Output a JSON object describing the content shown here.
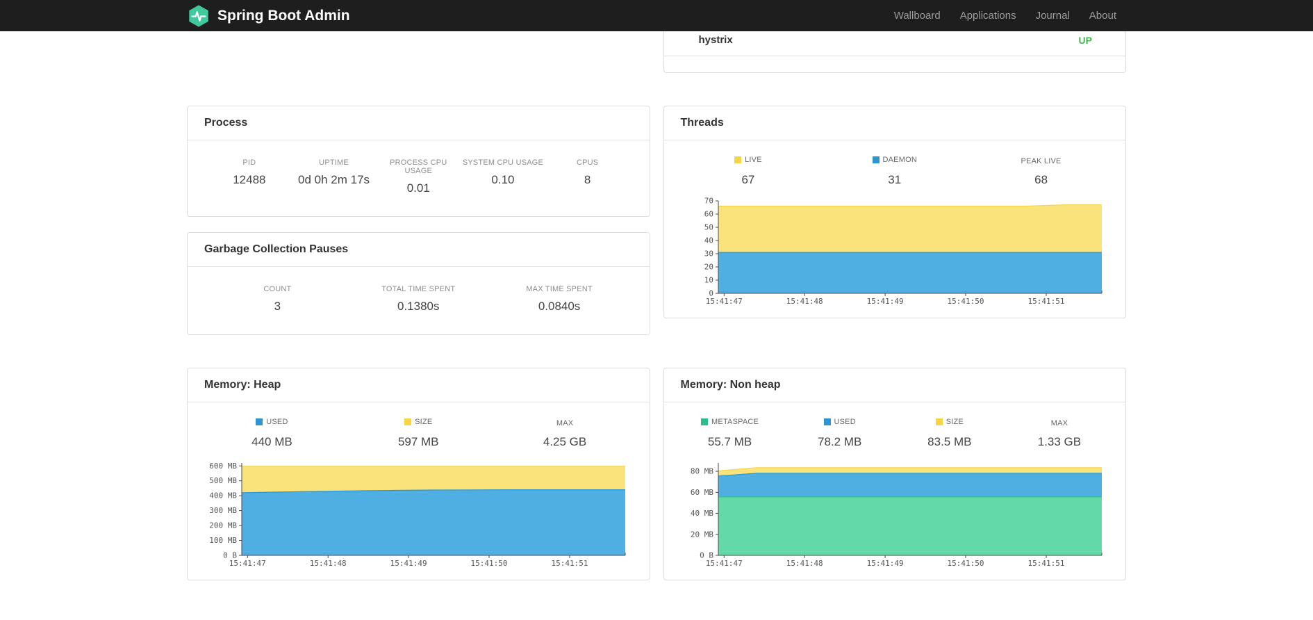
{
  "navbar": {
    "brand": "Spring Boot Admin",
    "brand_color": "#41c99e",
    "links": [
      {
        "label": "Wallboard"
      },
      {
        "label": "Applications"
      },
      {
        "label": "Journal"
      },
      {
        "label": "About"
      }
    ]
  },
  "health": {
    "rows": [
      {
        "name": "hystrix",
        "status": "UP",
        "status_color": "#43b749"
      }
    ]
  },
  "panels": {
    "process": {
      "title": "Process",
      "metrics": [
        {
          "label": "PID",
          "value": "12488"
        },
        {
          "label": "UPTIME",
          "value": "0d 0h 2m 17s"
        },
        {
          "label": "PROCESS CPU USAGE",
          "value": "0.01"
        },
        {
          "label": "SYSTEM CPU USAGE",
          "value": "0.10"
        },
        {
          "label": "CPUS",
          "value": "8"
        }
      ]
    },
    "gc": {
      "title": "Garbage Collection Pauses",
      "metrics": [
        {
          "label": "COUNT",
          "value": "3"
        },
        {
          "label": "TOTAL TIME SPENT",
          "value": "0.1380s"
        },
        {
          "label": "MAX TIME SPENT",
          "value": "0.0840s"
        }
      ]
    },
    "threads": {
      "title": "Threads",
      "legend": [
        {
          "label": "LIVE",
          "value": "67",
          "color": "#f6d645"
        },
        {
          "label": "DAEMON",
          "value": "31",
          "color": "#2d95d2"
        },
        {
          "label": "PEAK LIVE",
          "value": "68"
        }
      ]
    },
    "heap": {
      "title": "Memory: Heap",
      "legend": [
        {
          "label": "USED",
          "value": "440 MB",
          "color": "#2d95d2"
        },
        {
          "label": "SIZE",
          "value": "597 MB",
          "color": "#f6d645"
        },
        {
          "label": "MAX",
          "value": "4.25 GB"
        }
      ]
    },
    "nonheap": {
      "title": "Memory: Non heap",
      "legend": [
        {
          "label": "METASPACE",
          "value": "55.7 MB",
          "color": "#2dbd8d"
        },
        {
          "label": "USED",
          "value": "78.2 MB",
          "color": "#2d95d2"
        },
        {
          "label": "SIZE",
          "value": "83.5 MB",
          "color": "#f6d645"
        },
        {
          "label": "MAX",
          "value": "1.33 GB"
        }
      ]
    }
  },
  "chart_data": [
    {
      "id": "threads",
      "type": "area",
      "title": "Threads",
      "xlabel": "",
      "ylabel": "",
      "x": [
        "15:41:47",
        "15:41:48",
        "15:41:49",
        "15:41:50",
        "15:41:51"
      ],
      "ylim": [
        0,
        70
      ],
      "yticks": [
        {
          "v": 0,
          "label": "0"
        },
        {
          "v": 10,
          "label": "10"
        },
        {
          "v": 20,
          "label": "20"
        },
        {
          "v": 30,
          "label": "30"
        },
        {
          "v": 40,
          "label": "40"
        },
        {
          "v": 50,
          "label": "50"
        },
        {
          "v": 60,
          "label": "60"
        },
        {
          "v": 70,
          "label": "70"
        }
      ],
      "series": [
        {
          "name": "DAEMON",
          "color": "#2d95d2",
          "fill": "#4fafe2",
          "values": [
            31,
            31,
            31,
            31,
            31,
            31,
            31,
            31,
            31,
            31,
            31
          ]
        },
        {
          "name": "LIVE",
          "color": "#f6d645",
          "fill": "#fbe37b",
          "values": [
            66,
            66,
            66,
            66,
            66,
            66,
            66,
            66,
            66,
            67,
            67
          ]
        }
      ]
    },
    {
      "id": "heap",
      "type": "area",
      "title": "Memory: Heap",
      "xlabel": "",
      "ylabel": "",
      "x": [
        "15:41:47",
        "15:41:48",
        "15:41:49",
        "15:41:50",
        "15:41:51"
      ],
      "ylim": [
        0,
        620
      ],
      "yticks": [
        {
          "v": 0,
          "label": "0 B"
        },
        {
          "v": 100,
          "label": "100 MB"
        },
        {
          "v": 200,
          "label": "200 MB"
        },
        {
          "v": 300,
          "label": "300 MB"
        },
        {
          "v": 400,
          "label": "400 MB"
        },
        {
          "v": 500,
          "label": "500 MB"
        },
        {
          "v": 600,
          "label": "600 MB"
        }
      ],
      "series": [
        {
          "name": "USED",
          "color": "#2d95d2",
          "fill": "#4fafe2",
          "values": [
            420,
            425,
            429,
            433,
            436,
            438,
            439,
            440,
            440,
            440,
            440
          ]
        },
        {
          "name": "SIZE",
          "color": "#f6d645",
          "fill": "#fbe37b",
          "values": [
            597,
            597,
            597,
            597,
            597,
            597,
            597,
            597,
            597,
            597,
            597
          ]
        }
      ]
    },
    {
      "id": "nonheap",
      "type": "area",
      "title": "Memory: Non heap",
      "xlabel": "",
      "ylabel": "",
      "x": [
        "15:41:47",
        "15:41:48",
        "15:41:49",
        "15:41:50",
        "15:41:51"
      ],
      "ylim": [
        0,
        88
      ],
      "yticks": [
        {
          "v": 0,
          "label": "0 B"
        },
        {
          "v": 20,
          "label": "20 MB"
        },
        {
          "v": 40,
          "label": "40 MB"
        },
        {
          "v": 60,
          "label": "60 MB"
        },
        {
          "v": 80,
          "label": "80 MB"
        }
      ],
      "series": [
        {
          "name": "METASPACE",
          "color": "#2dbd8d",
          "fill": "#63d9a8",
          "values": [
            55.7,
            55.7,
            55.7,
            55.7,
            55.7,
            55.7,
            55.7,
            55.7,
            55.7,
            55.7,
            55.7
          ]
        },
        {
          "name": "USED",
          "color": "#2d95d2",
          "fill": "#4fafe2",
          "values": [
            75.5,
            78.2,
            78.2,
            78.2,
            78.2,
            78.2,
            78.2,
            78.2,
            78.2,
            78.2,
            78.2
          ]
        },
        {
          "name": "SIZE",
          "color": "#f6d645",
          "fill": "#fbe37b",
          "values": [
            80.5,
            83.5,
            83.5,
            83.5,
            83.5,
            83.5,
            83.5,
            83.5,
            83.5,
            83.5,
            83.5
          ]
        }
      ]
    }
  ]
}
